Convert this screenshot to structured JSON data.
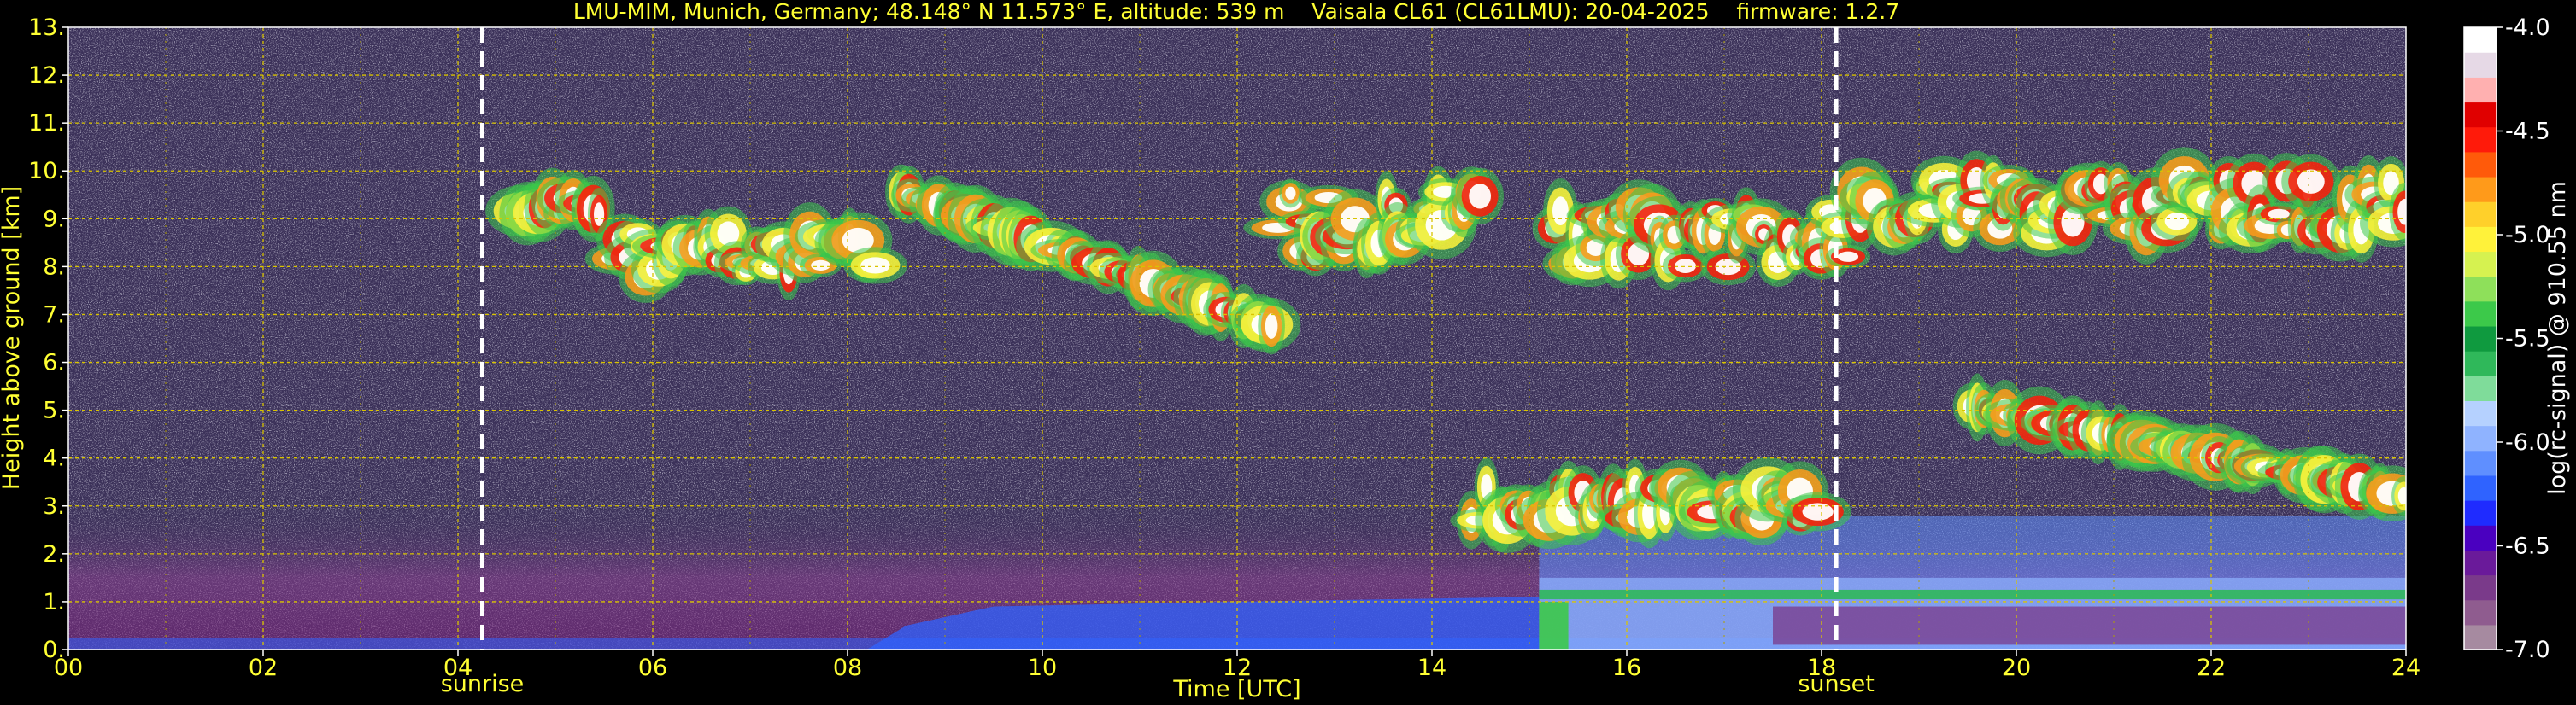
{
  "chart_data": {
    "type": "heatmap",
    "title": "LMU-MIM, Munich, Germany; 48.148° N 11.573° E, altitude: 539 m    Vaisala CL61 (CL61LMU): 20-04-2025    firmware: 1.2.7",
    "xlabel": "Time [UTC]",
    "ylabel": "Height above ground [km]",
    "xlim": [
      0,
      24
    ],
    "ylim": [
      0,
      13
    ],
    "x_ticks": [
      "00",
      "02",
      "04",
      "06",
      "08",
      "10",
      "12",
      "14",
      "16",
      "18",
      "20",
      "22",
      "24"
    ],
    "y_ticks": [
      "0.",
      "1.",
      "2.",
      "3.",
      "4.",
      "5.",
      "6.",
      "7.",
      "8.",
      "9.",
      "10.",
      "11.",
      "12.",
      "13."
    ],
    "grid": true,
    "colorbar": {
      "label": "log(rc-signal) @ 910.55 nm",
      "range": [
        -7.0,
        -4.0
      ],
      "ticks": [
        "-4.0",
        "-4.5",
        "-5.0",
        "-5.5",
        "-6.0",
        "-6.5",
        "-7.0"
      ],
      "colors": [
        "#a68aa0",
        "#8f5c8f",
        "#7a3a8a",
        "#6a1a9a",
        "#4a00c0",
        "#1f2bff",
        "#2f63ff",
        "#5f8fff",
        "#8fb3ff",
        "#b5d1ff",
        "#7fdc9a",
        "#2fb85a",
        "#0f9a3f",
        "#3cc94a",
        "#8ee05a",
        "#d6f250",
        "#fff23a",
        "#ffd02a",
        "#ff9a1a",
        "#ff5a0a",
        "#ff1a0a",
        "#e00000",
        "#ffb0b0",
        "#e6d9e6",
        "#ffffff"
      ]
    },
    "markers": [
      {
        "label": "sunrise",
        "x": 4.25
      },
      {
        "label": "sunset",
        "x": 18.15
      }
    ],
    "features": [
      {
        "name": "cirrus layer 1",
        "t_start": 4.6,
        "t_end": 5.5,
        "h_low": 8.8,
        "h_high": 9.6
      },
      {
        "name": "cirrus layer 2",
        "t_start": 5.6,
        "t_end": 8.3,
        "h_low": 7.2,
        "h_high": 9.1
      },
      {
        "name": "cirrus layer 3",
        "t_start": 8.5,
        "t_end": 12.4,
        "h_low": 6.4,
        "h_high": 9.6
      },
      {
        "name": "cirrus layer 4",
        "t_start": 12.4,
        "t_end": 14.5,
        "h_low": 7.3,
        "h_high": 10.2
      },
      {
        "name": "cirrus layer 5",
        "t_start": 15.2,
        "t_end": 18.4,
        "h_low": 7.2,
        "h_high": 9.8
      },
      {
        "name": "cirrus layer 6",
        "t_start": 18.4,
        "t_end": 24.0,
        "h_low": 8.0,
        "h_high": 10.3
      },
      {
        "name": "mid-level layer",
        "t_start": 14.4,
        "t_end": 18.0,
        "h_low": 2.2,
        "h_high": 3.8
      },
      {
        "name": "descending layer",
        "t_start": 19.5,
        "t_end": 24.0,
        "h_low": 3.2,
        "h_high": 5.1
      },
      {
        "name": "boundary layer",
        "t_start": 15.1,
        "t_end": 24.0,
        "h_low": 0.0,
        "h_high": 1.5
      }
    ]
  }
}
